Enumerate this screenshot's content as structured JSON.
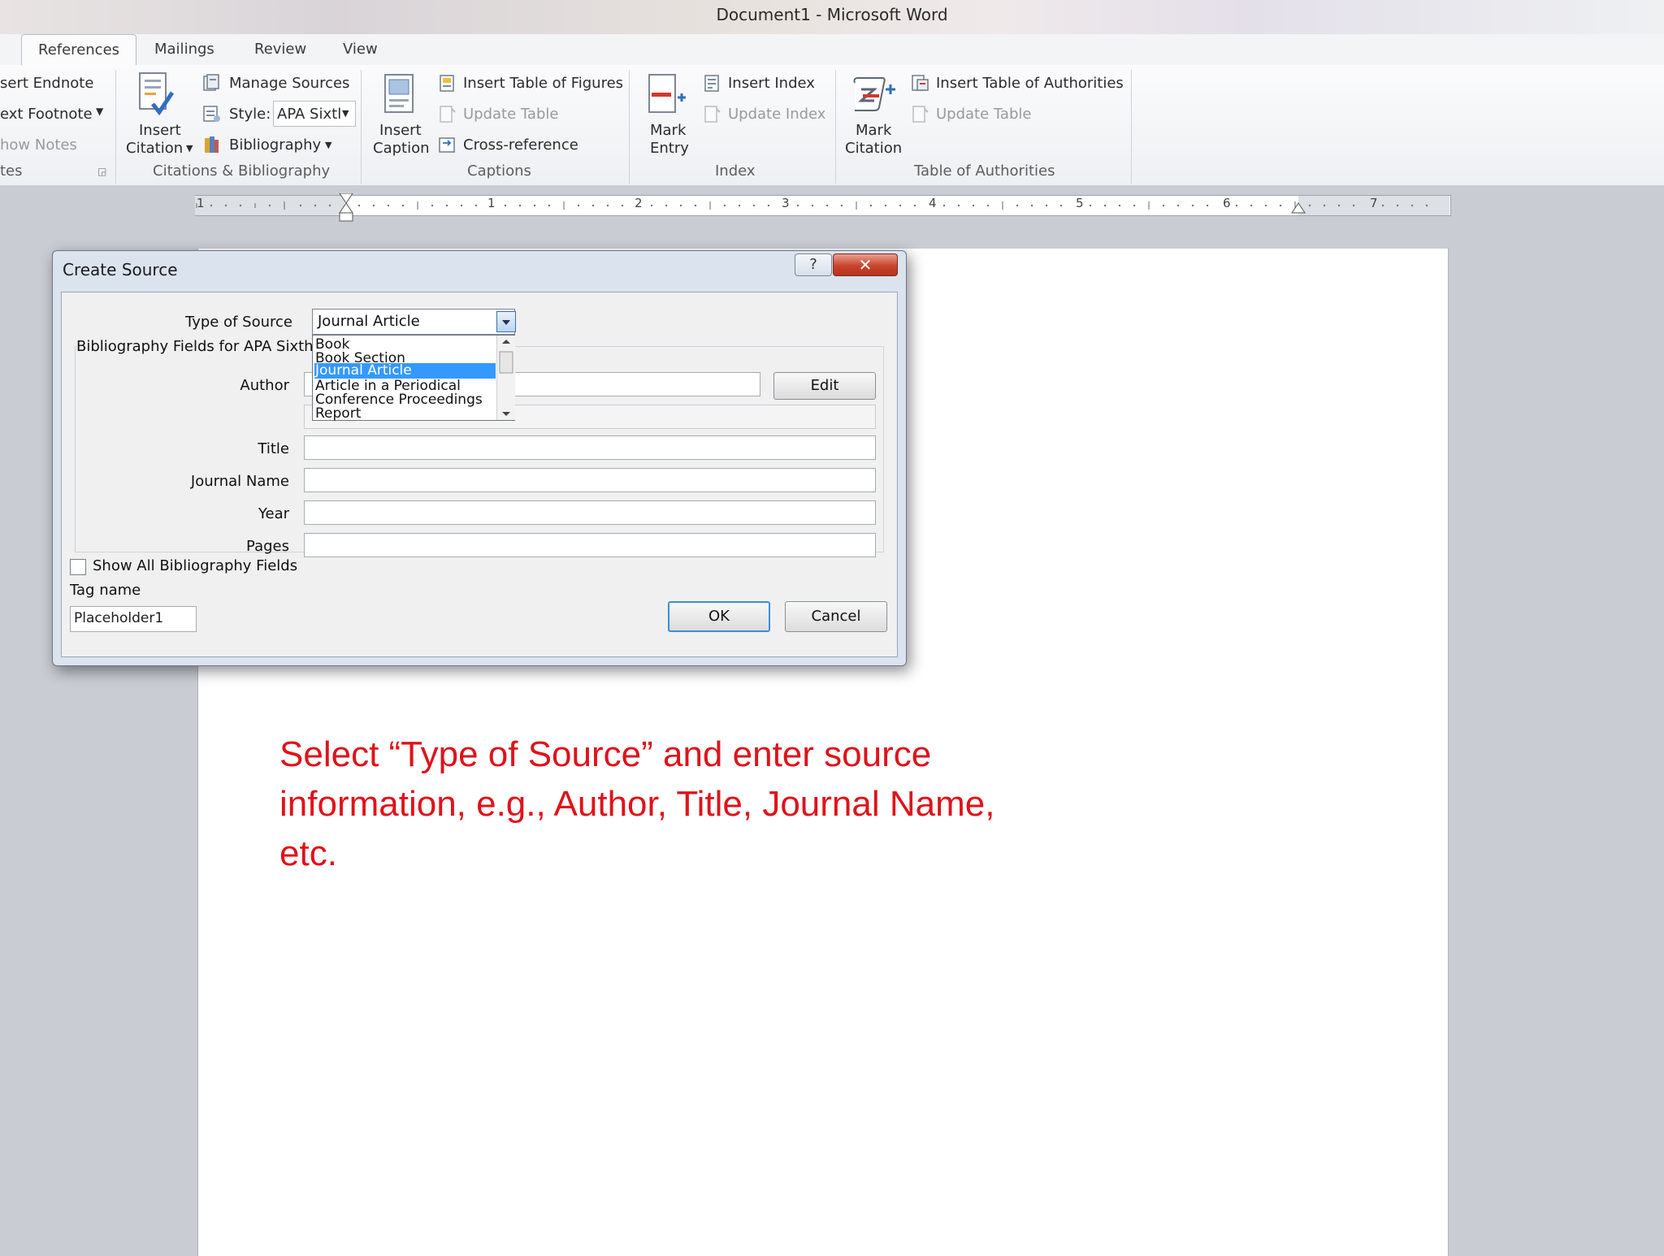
{
  "window": {
    "title": "Document1 - Microsoft Word"
  },
  "tabs": [
    {
      "label": "References",
      "active": true
    },
    {
      "label": "Mailings",
      "active": false
    },
    {
      "label": "Review",
      "active": false
    },
    {
      "label": "View",
      "active": false
    }
  ],
  "ribbon": {
    "footnotes": {
      "insert_endnote": "sert Endnote",
      "next_footnote": "ext Footnote",
      "show_notes": "how Notes",
      "group_label": "tes"
    },
    "citations": {
      "insert_citation_line1": "Insert",
      "insert_citation_line2": "Citation",
      "manage_sources": "Manage Sources",
      "style_label": "Style:",
      "style_value": "APA Sixtl",
      "bibliography": "Bibliography",
      "group_label": "Citations & Bibliography"
    },
    "captions": {
      "insert_caption_line1": "Insert",
      "insert_caption_line2": "Caption",
      "insert_table_of_figures": "Insert Table of Figures",
      "update_table": "Update Table",
      "cross_reference": "Cross-reference",
      "group_label": "Captions"
    },
    "index": {
      "mark_entry_line1": "Mark",
      "mark_entry_line2": "Entry",
      "insert_index": "Insert Index",
      "update_index": "Update Index",
      "group_label": "Index"
    },
    "authorities": {
      "mark_citation_line1": "Mark",
      "mark_citation_line2": "Citation",
      "insert_table_of_authorities": "Insert Table of Authorities",
      "update_table": "Update Table",
      "group_label": "Table of Authorities"
    }
  },
  "ruler": {
    "numbers": [
      "1",
      "1",
      "2",
      "3",
      "4",
      "5",
      "6",
      "7"
    ]
  },
  "dialog": {
    "title": "Create Source",
    "help": "?",
    "close": "✕",
    "type_of_source_label": "Type of Source",
    "type_of_source_value": "Journal Article",
    "bib_fields_label": "Bibliography Fields for APA Sixth E",
    "dropdown_options": [
      {
        "label": "Book",
        "selected": false
      },
      {
        "label": "Book Section",
        "selected": false
      },
      {
        "label": "Journal Article",
        "selected": true
      },
      {
        "label": "Article in a Periodical",
        "selected": false
      },
      {
        "label": "Conference Proceedings",
        "selected": false
      },
      {
        "label": "Report",
        "selected": false
      }
    ],
    "author_label": "Author",
    "edit_button": "Edit",
    "title_label": "Title",
    "journal_name_label": "Journal Name",
    "year_label": "Year",
    "pages_label": "Pages",
    "show_all_label": "Show All Bibliography Fields",
    "tag_name_label": "Tag name",
    "tag_name_value": "Placeholder1",
    "ok_button": "OK",
    "cancel_button": "Cancel"
  },
  "instruction": "Select “Type of Source” and enter source information, e.g., Author, Title, Journal Name, etc.",
  "colors": {
    "instruction": "#e0121a",
    "selection": "#3399ff",
    "close_button": "#c8442c"
  }
}
